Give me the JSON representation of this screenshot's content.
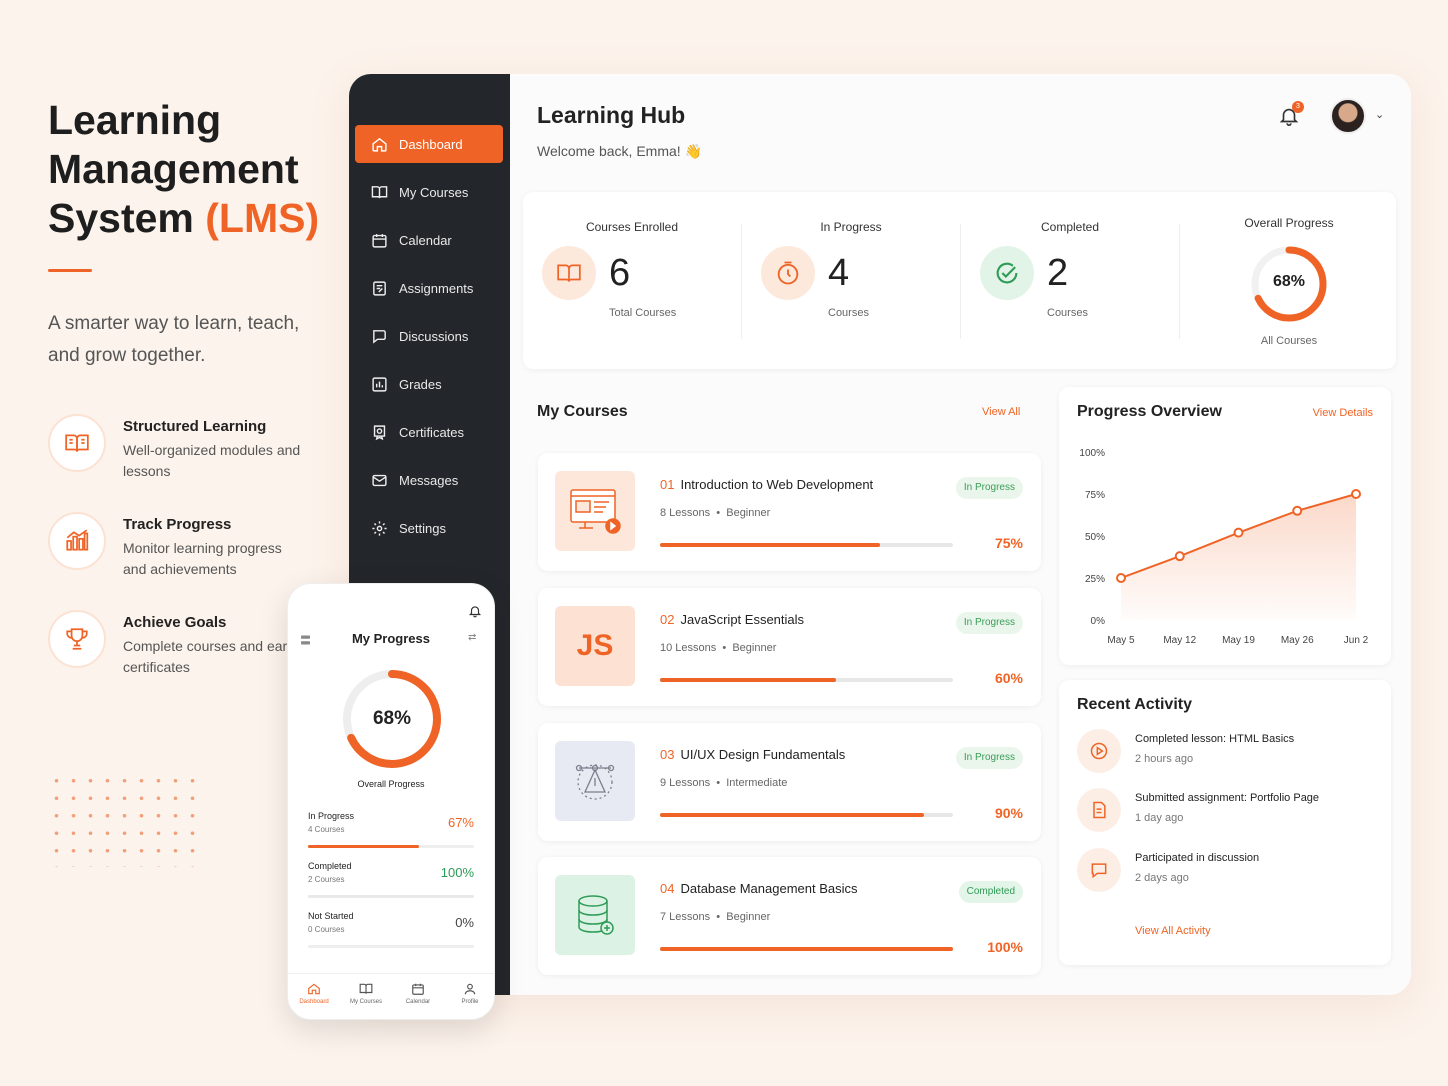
{
  "hero": {
    "title_line1": "Learning",
    "title_line2": "Management",
    "title_line3_main": "System",
    "title_line3_accent": "(LMS)",
    "tagline": "A smarter way to learn, teach, and grow together.",
    "features": [
      {
        "title": "Structured Learning",
        "desc": "Well-organized modules and lessons",
        "icon": "book-icon"
      },
      {
        "title": "Track Progress",
        "desc": "Monitor learning progress and achievements",
        "icon": "bar-chart-icon"
      },
      {
        "title": "Achieve Goals",
        "desc": "Complete courses and earn certificates",
        "icon": "trophy-icon"
      }
    ]
  },
  "sidebar": {
    "items": [
      {
        "label": "Dashboard",
        "icon": "home-icon",
        "active": true
      },
      {
        "label": "My Courses",
        "icon": "book-icon"
      },
      {
        "label": "Calendar",
        "icon": "calendar-icon"
      },
      {
        "label": "Assignments",
        "icon": "assignment-icon"
      },
      {
        "label": "Discussions",
        "icon": "chat-icon"
      },
      {
        "label": "Grades",
        "icon": "grades-icon"
      },
      {
        "label": "Certificates",
        "icon": "certificate-icon"
      },
      {
        "label": "Messages",
        "icon": "mail-icon"
      },
      {
        "label": "Settings",
        "icon": "gear-icon"
      }
    ]
  },
  "header": {
    "title": "Learning Hub",
    "welcome": "Welcome back, Emma! 👋",
    "notification_count": "3"
  },
  "stats": {
    "enrolled": {
      "label": "Courses Enrolled",
      "value": "6",
      "sub": "Total Courses"
    },
    "in_progress": {
      "label": "In Progress",
      "value": "4",
      "sub": "Courses"
    },
    "completed": {
      "label": "Completed",
      "value": "2",
      "sub": "Courses"
    },
    "overall": {
      "label": "Overall Progress",
      "value": "68%",
      "sub": "All Courses",
      "percent": 68
    }
  },
  "my_courses": {
    "title": "My Courses",
    "view_all": "View All",
    "items": [
      {
        "num": "01",
        "title": "Introduction to Web Development",
        "lessons": "8 Lessons",
        "level": "Beginner",
        "status": "In Progress",
        "percent_label": "75%",
        "percent": 75
      },
      {
        "num": "02",
        "title": "JavaScript Essentials",
        "lessons": "10 Lessons",
        "level": "Beginner",
        "status": "In Progress",
        "percent_label": "60%",
        "percent": 60,
        "thumb_text": "JS"
      },
      {
        "num": "03",
        "title": "UI/UX Design Fundamentals",
        "lessons": "9 Lessons",
        "level": "Intermediate",
        "status": "In Progress",
        "percent_label": "90%",
        "percent": 90
      },
      {
        "num": "04",
        "title": "Database Management Basics",
        "lessons": "7 Lessons",
        "level": "Beginner",
        "status": "Completed",
        "percent_label": "100%",
        "percent": 100
      }
    ]
  },
  "progress_overview": {
    "title": "Progress Overview",
    "view_details": "View Details"
  },
  "chart_data": {
    "type": "area",
    "x": [
      "May 5",
      "May 12",
      "May 19",
      "May 26",
      "Jun 2"
    ],
    "series": [
      {
        "values": [
          25,
          38,
          52,
          65,
          75
        ]
      }
    ],
    "yticks": [
      "100%",
      "75%",
      "50%",
      "25%",
      "0%"
    ],
    "ylim": [
      0,
      100
    ],
    "grid": false,
    "color": "#ef6426"
  },
  "recent_activity": {
    "title": "Recent Activity",
    "items": [
      {
        "title": "Completed lesson: HTML Basics",
        "time": "2 hours ago",
        "icon": "play-icon"
      },
      {
        "title": "Submitted assignment: Portfolio Page",
        "time": "1 day ago",
        "icon": "document-icon"
      },
      {
        "title": "Participated in discussion",
        "time": "2 days ago",
        "icon": "chat-icon"
      }
    ],
    "view_all": "View All Activity"
  },
  "phone": {
    "title": "My Progress",
    "overall_value": "68%",
    "overall_label": "Overall Progress",
    "overall_percent": 68,
    "rows": [
      {
        "label": "In Progress",
        "sub": "4 Courses",
        "value": "67%",
        "percent": 67,
        "color": "#ef6426"
      },
      {
        "label": "Completed",
        "sub": "2 Courses",
        "value": "100%",
        "percent": 100,
        "color": "#2f9b56"
      },
      {
        "label": "Not Started",
        "sub": "0 Courses",
        "value": "0%",
        "percent": 0,
        "color": "#444444"
      }
    ],
    "tabs": [
      "Dashboard",
      "My Courses",
      "Calendar",
      "Profile"
    ]
  },
  "colors": {
    "accent": "#ef6426",
    "sidebar": "#23272b",
    "success": "#2f9b56"
  }
}
